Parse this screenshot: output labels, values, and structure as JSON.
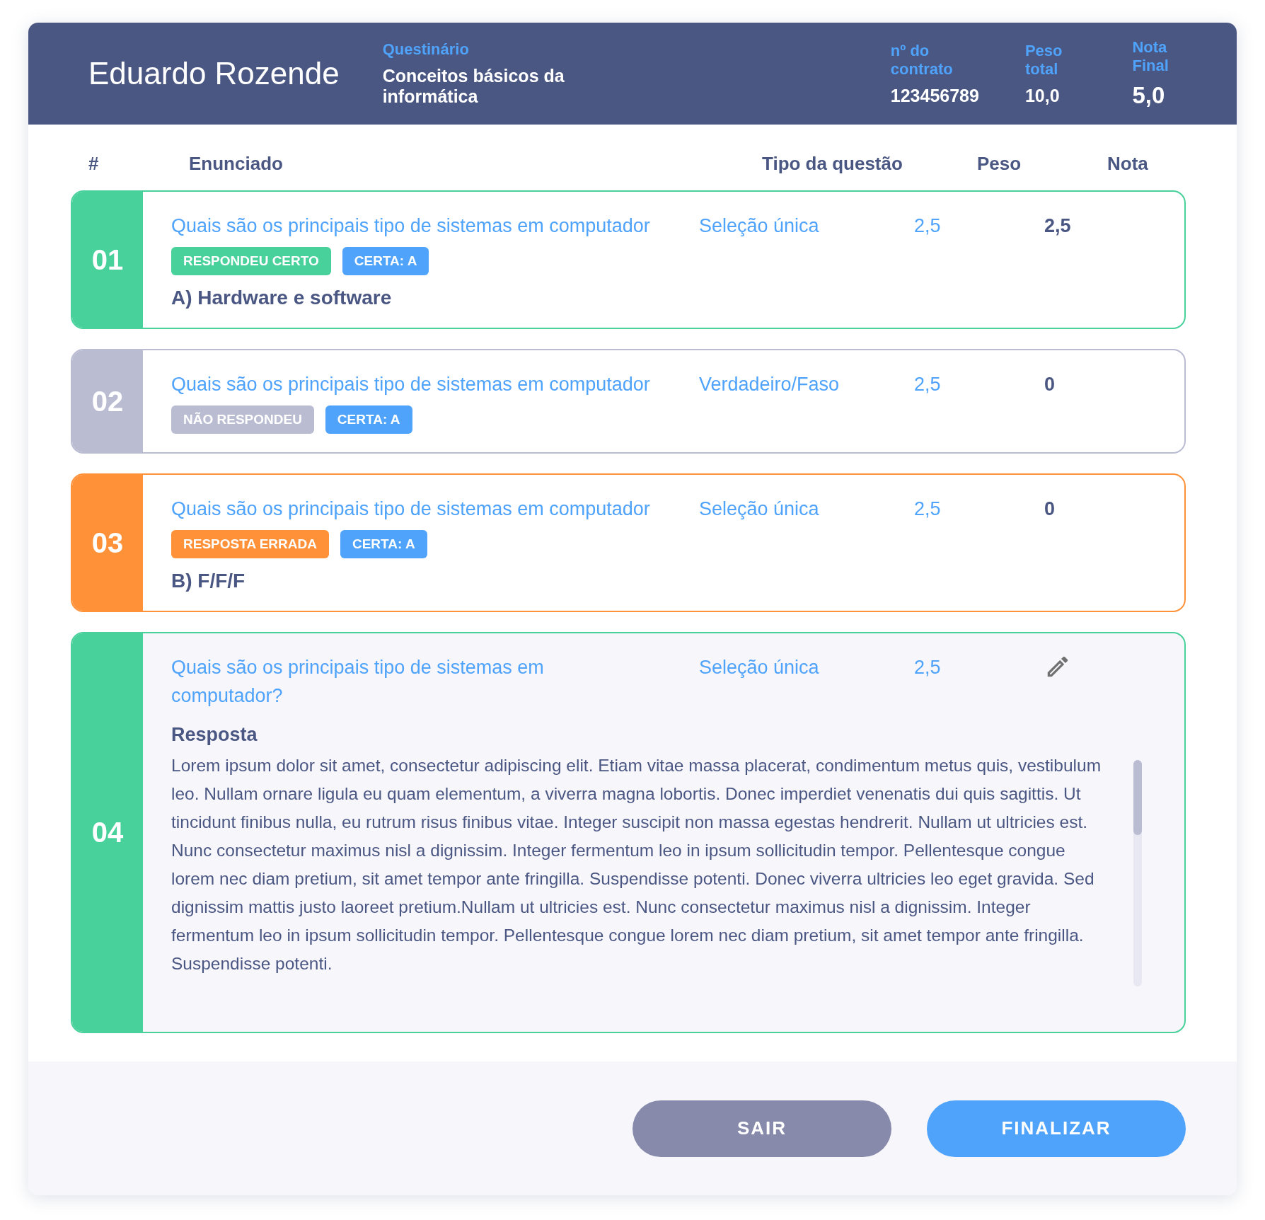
{
  "header": {
    "name": "Eduardo Rozende",
    "fields": [
      {
        "label": "Questinário",
        "value": "Conceitos básicos da informática",
        "kind": "normal"
      },
      {
        "label": "nº do contrato",
        "value": "123456789",
        "kind": "normal"
      },
      {
        "label": "Peso total",
        "value": "10,0",
        "kind": "normal"
      },
      {
        "label": "Nota Final",
        "value": "5,0",
        "kind": "large"
      }
    ]
  },
  "table": {
    "columns": [
      "#",
      "Enunciado",
      "Tipo da questão",
      "Peso",
      "Nota"
    ],
    "rows": [
      {
        "kind": "choice",
        "number": "01",
        "color": "#48d19b",
        "question": "Quais são os principais tipo de sistemas em computador",
        "type": "Seleção única",
        "weight": "2,5",
        "grade": "2,5",
        "tags": [
          {
            "label": "RESPONDEU CERTO",
            "color": "#48d19b"
          },
          {
            "label": "CERTA: A",
            "color": "#4fa3fb"
          }
        ],
        "answer": "A) Hardware e software"
      },
      {
        "kind": "choice",
        "number": "02",
        "color": "#babcd2",
        "question": "Quais são os principais tipo de sistemas em computador",
        "type": "Verdadeiro/Faso",
        "weight": "2,5",
        "grade": "0",
        "tags": [
          {
            "label": "NÃO RESPONDEU",
            "color": "#babcd2"
          },
          {
            "label": "CERTA: A",
            "color": "#4fa3fb"
          }
        ]
      },
      {
        "kind": "choice",
        "number": "03",
        "color": "#ff9139",
        "question": "Quais são os principais tipo de sistemas em computador",
        "type": "Seleção única",
        "weight": "2,5",
        "grade": "0",
        "tags": [
          {
            "label": "RESPOSTA ERRADA",
            "color": "#ff9139"
          },
          {
            "label": "CERTA: A",
            "color": "#4fa3fb"
          }
        ],
        "answer": "B) F/F/F"
      },
      {
        "kind": "essay",
        "number": "04",
        "color": "#48d19b",
        "question": "Quais são os principais tipo de sistemas em computador?",
        "type": "Seleção única",
        "weight": "2,5",
        "answer_label": "Resposta",
        "answer": "Lorem ipsum dolor sit amet, consectetur adipiscing elit. Etiam vitae massa placerat, condimentum metus quis, vestibulum leo. Nullam ornare ligula eu quam elementum, a viverra magna lobortis. Donec imperdiet venenatis dui quis sagittis. Ut tincidunt finibus nulla, eu rutrum risus finibus vitae. Integer suscipit non massa egestas hendrerit. Nullam ut ultricies est. Nunc consectetur maximus nisl a dignissim. Integer fermentum leo in ipsum sollicitudin tempor. Pellentesque congue lorem nec diam pretium, sit amet tempor ante fringilla. Suspendisse potenti. Donec viverra ultricies leo eget gravida. Sed dignissim mattis justo laoreet pretium.Nullam ut ultricies est. Nunc consectetur maximus nisl a dignissim. Integer fermentum leo in ipsum sollicitudin tempor. Pellentesque congue lorem nec diam pretium, sit amet tempor ante fringilla. Suspendisse potenti."
      }
    ]
  },
  "buttons": [
    {
      "label": "SAIR",
      "kind": "secondary"
    },
    {
      "label": "FINALIZAR",
      "kind": "primary"
    }
  ]
}
